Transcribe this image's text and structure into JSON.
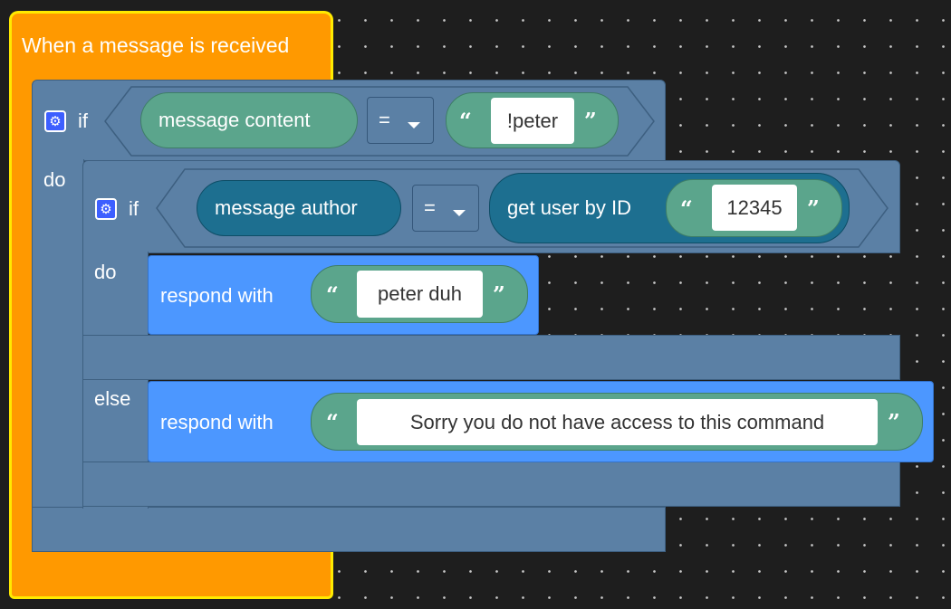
{
  "event_block": {
    "label": "When a message is received",
    "color": "#ff9900",
    "outline": "#ffea00"
  },
  "outer_if": {
    "if_label": "if",
    "do_label": "do",
    "condition": {
      "left": "message content",
      "operator": "=",
      "value": "!peter"
    }
  },
  "inner_if": {
    "if_label": "if",
    "do_label": "do",
    "else_label": "else",
    "condition": {
      "left": "message author",
      "operator": "=",
      "function": "get user by ID",
      "value": "12345"
    }
  },
  "respond_do": {
    "label": "respond with",
    "value": "peter duh"
  },
  "respond_else": {
    "label": "respond with",
    "value": "Sorry you do not have access to this command"
  },
  "icons": {
    "mutator": "gear-icon",
    "dropdown": "caret-down-icon",
    "quote_open": "“",
    "quote_close": "”"
  },
  "colors": {
    "control": "#5b80a5",
    "string": "#5ba58c",
    "discord": "#1d6f90",
    "action": "#4c97ff"
  }
}
